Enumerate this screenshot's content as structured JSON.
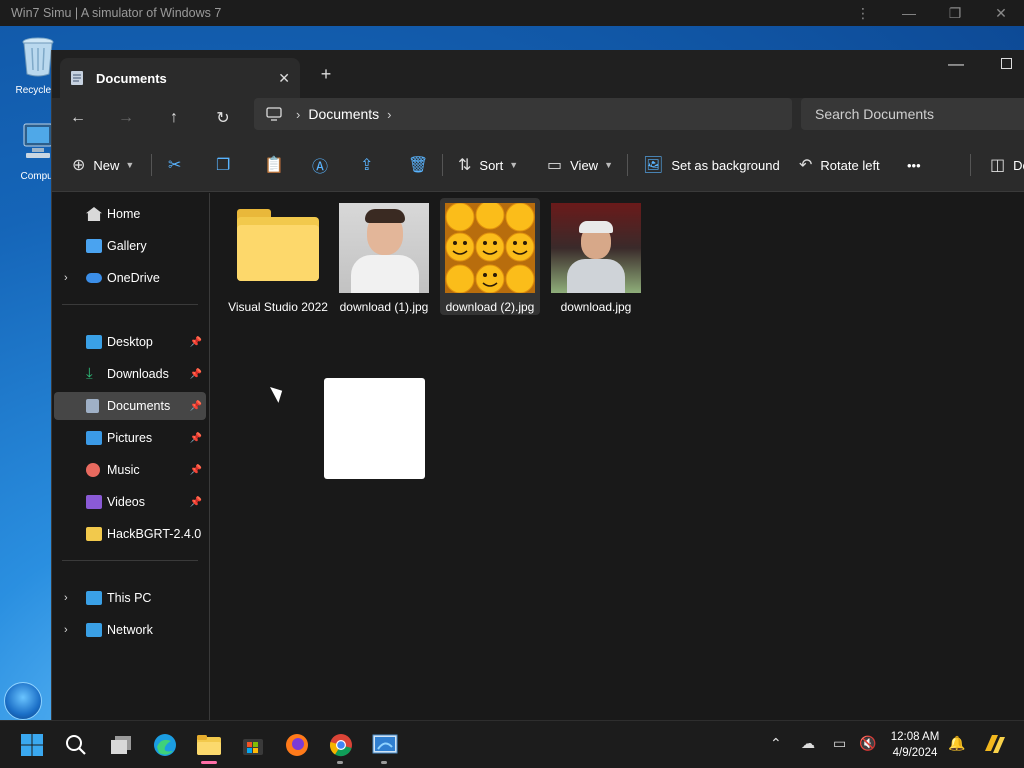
{
  "host": {
    "title": "Win7 Simu | A simulator of Windows 7",
    "menu_icon": "kebab-menu-icon"
  },
  "desktop": {
    "icons": [
      {
        "label": "Recycle B",
        "icon": "recycle-bin-icon"
      },
      {
        "label": "Comput",
        "icon": "computer-icon"
      }
    ]
  },
  "explorer": {
    "tab": {
      "label": "Documents",
      "close": "✕"
    },
    "new_tab": "+",
    "address": {
      "segments": [
        "Documents"
      ]
    },
    "search": {
      "placeholder": "Search Documents"
    },
    "commands": {
      "new": "New",
      "sort": "Sort",
      "view": "View",
      "set_background": "Set as background",
      "rotate_left": "Rotate left",
      "more": "•••",
      "details": "De"
    },
    "sidebar": {
      "top": [
        {
          "label": "Home",
          "icon": "home-icon",
          "color": "#d9d9d9"
        },
        {
          "label": "Gallery",
          "icon": "gallery-icon",
          "color": "#4aa3f0"
        },
        {
          "label": "OneDrive",
          "icon": "cloud-icon",
          "color": "#3b8ee8"
        }
      ],
      "pinned": [
        {
          "label": "Desktop",
          "icon": "desktop-icon",
          "color": "#3aa0e6"
        },
        {
          "label": "Downloads",
          "icon": "download-icon",
          "color": "#2fbf7a"
        },
        {
          "label": "Documents",
          "icon": "documents-icon",
          "color": "#9fb0c6"
        },
        {
          "label": "Pictures",
          "icon": "pictures-icon",
          "color": "#3b9ae6"
        },
        {
          "label": "Music",
          "icon": "music-icon",
          "color": "#e86a5f"
        },
        {
          "label": "Videos",
          "icon": "videos-icon",
          "color": "#8a5ad6"
        },
        {
          "label": "HackBGRT-2.4.0",
          "icon": "folder-icon",
          "color": "#f2c94c"
        }
      ],
      "bottom": [
        {
          "label": "This PC",
          "icon": "pc-icon",
          "color": "#3aa0e6"
        },
        {
          "label": "Network",
          "icon": "network-icon",
          "color": "#3aa0e6"
        }
      ]
    },
    "files": [
      {
        "name": "Visual Studio 2022",
        "kind": "folder"
      },
      {
        "name": "download (1).jpg",
        "kind": "image"
      },
      {
        "name": "download (2).jpg",
        "kind": "image"
      },
      {
        "name": "download.jpg",
        "kind": "image"
      }
    ]
  },
  "taskbar": {
    "clock": {
      "time": "12:08 AM",
      "date": "4/9/2024"
    },
    "apps": [
      "start-icon",
      "search-icon",
      "task-view-icon",
      "edge-icon",
      "file-explorer-icon",
      "store-icon",
      "firefox-icon",
      "chrome-icon",
      "win7-simu-icon"
    ]
  }
}
